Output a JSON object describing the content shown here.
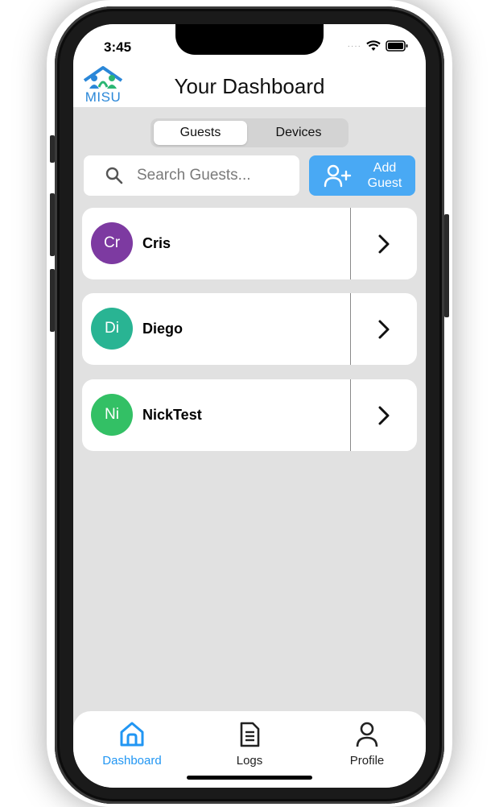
{
  "status_bar": {
    "time": "3:45"
  },
  "header": {
    "title": "Your Dashboard",
    "logo_text": "MISU"
  },
  "segmented_control": {
    "options": [
      "Guests",
      "Devices"
    ],
    "selected": "Guests"
  },
  "search": {
    "placeholder": "Search Guests..."
  },
  "add_guest": {
    "label_line1": "Add",
    "label_line2": "Guest"
  },
  "guests": [
    {
      "initials": "Cr",
      "name": "Cris",
      "color": "#7d3aa1"
    },
    {
      "initials": "Di",
      "name": "Diego",
      "color": "#29b493"
    },
    {
      "initials": "Ni",
      "name": "NickTest",
      "color": "#33c065"
    }
  ],
  "tabs": [
    {
      "label": "Dashboard",
      "icon": "home-icon",
      "active": true
    },
    {
      "label": "Logs",
      "icon": "document-icon",
      "active": false
    },
    {
      "label": "Profile",
      "icon": "person-icon",
      "active": false
    }
  ],
  "colors": {
    "accent": "#49a9f4",
    "tab_active": "#2196f3",
    "background": "#e1e1e1"
  }
}
